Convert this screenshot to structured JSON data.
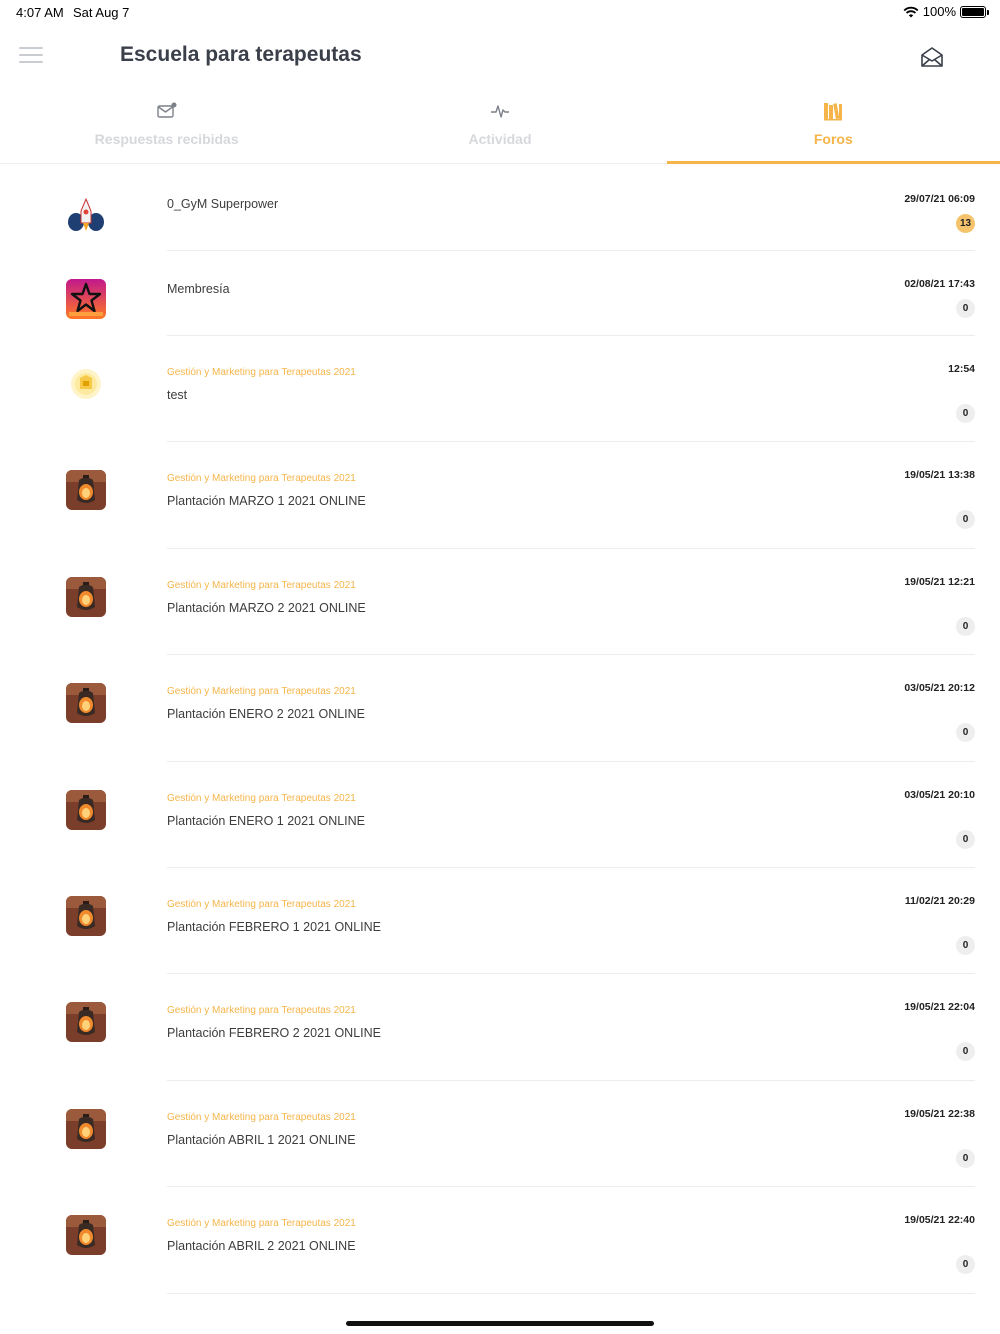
{
  "status_bar": {
    "time": "4:07 AM",
    "date": "Sat Aug 7",
    "battery": "100%"
  },
  "header": {
    "title": "Escuela para terapeutas"
  },
  "tabs": [
    {
      "label": "Respuestas recibidas",
      "icon": "envelope-notification-icon",
      "active": false
    },
    {
      "label": "Actividad",
      "icon": "activity-pulse-icon",
      "active": false
    },
    {
      "label": "Foros",
      "icon": "books-icon",
      "active": true
    }
  ],
  "forums": [
    {
      "category": "",
      "title": "0_GyM Superpower",
      "date": "29/07/21 06:09",
      "count": "13",
      "avatar": "rocket-avatar"
    },
    {
      "category": "",
      "title": "Membresía",
      "date": "02/08/21 17:43",
      "count": "0",
      "avatar": "star-membership-avatar"
    },
    {
      "category": "Gestión y Marketing para Terapeutas 2021",
      "title": "test",
      "date": "12:54",
      "count": "0",
      "avatar": "badge-avatar"
    },
    {
      "category": "Gestión y Marketing para Terapeutas 2021",
      "title": "Plantación MARZO 1 2021 ONLINE",
      "date": "19/05/21 13:38",
      "count": "0",
      "avatar": "lantern-avatar"
    },
    {
      "category": "Gestión y Marketing para Terapeutas 2021",
      "title": "Plantación MARZO 2 2021 ONLINE",
      "date": "19/05/21 12:21",
      "count": "0",
      "avatar": "lantern-avatar"
    },
    {
      "category": "Gestión y Marketing para Terapeutas 2021",
      "title": "Plantación ENERO 2 2021 ONLINE",
      "date": "03/05/21 20:12",
      "count": "0",
      "avatar": "lantern-avatar"
    },
    {
      "category": "Gestión y Marketing para Terapeutas 2021",
      "title": "Plantación ENERO 1 2021 ONLINE",
      "date": "03/05/21 20:10",
      "count": "0",
      "avatar": "lantern-avatar"
    },
    {
      "category": "Gestión y Marketing para Terapeutas 2021",
      "title": "Plantación FEBRERO 1 2021 ONLINE",
      "date": "11/02/21 20:29",
      "count": "0",
      "avatar": "lantern-avatar"
    },
    {
      "category": "Gestión y Marketing para Terapeutas 2021",
      "title": "Plantación FEBRERO 2 2021 ONLINE",
      "date": "19/05/21 22:04",
      "count": "0",
      "avatar": "lantern-avatar"
    },
    {
      "category": "Gestión y Marketing para Terapeutas 2021",
      "title": "Plantación ABRIL 1 2021 ONLINE",
      "date": "19/05/21 22:38",
      "count": "0",
      "avatar": "lantern-avatar"
    },
    {
      "category": "Gestión y Marketing para Terapeutas 2021",
      "title": "Plantación ABRIL 2 2021 ONLINE",
      "date": "19/05/21 22:40",
      "count": "0",
      "avatar": "lantern-avatar"
    }
  ],
  "colors": {
    "accent": "#f5b54a",
    "badge_highlight": "#f5c36c",
    "badge_default": "#eeeeee",
    "inactive_tab": "#d6d8dc"
  }
}
